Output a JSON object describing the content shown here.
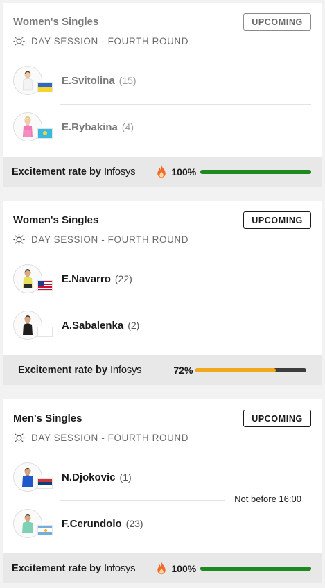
{
  "matches": [
    {
      "title": "Women's Singles",
      "status": "UPCOMING",
      "session": "DAY SESSION - FOURTH ROUND",
      "players": [
        {
          "name": "E.Svitolina",
          "seed": "(15)",
          "flag": "Ukraine"
        },
        {
          "name": "E.Rybakina",
          "seed": "(4)",
          "flag": "Kazakhstan"
        }
      ],
      "excitement": {
        "label": "Excitement rate by",
        "brand": "Infosys",
        "percent": "100%",
        "level": 1.0,
        "hot": true,
        "color": "#1e8a1e"
      }
    },
    {
      "title": "Women's Singles",
      "status": "UPCOMING",
      "session": "DAY SESSION - FOURTH ROUND",
      "players": [
        {
          "name": "E.Navarro",
          "seed": "(22)",
          "flag": "USA"
        },
        {
          "name": "A.Sabalenka",
          "seed": "(2)",
          "flag": "none"
        }
      ],
      "excitement": {
        "label": "Excitement rate by",
        "brand": "Infosys",
        "percent": "72%",
        "level": 0.72,
        "hot": false,
        "color": "#f0a81c"
      }
    },
    {
      "title": "Men's Singles",
      "status": "UPCOMING",
      "session": "DAY SESSION - FOURTH ROUND",
      "note": "Not before 16:00",
      "players": [
        {
          "name": "N.Djokovic",
          "seed": "(1)",
          "flag": "Serbia"
        },
        {
          "name": "F.Cerundolo",
          "seed": "(23)",
          "flag": "Argentina"
        }
      ],
      "excitement": {
        "label": "Excitement rate by",
        "brand": "Infosys",
        "percent": "100%",
        "level": 1.0,
        "hot": true,
        "color": "#1e8a1e"
      }
    }
  ]
}
